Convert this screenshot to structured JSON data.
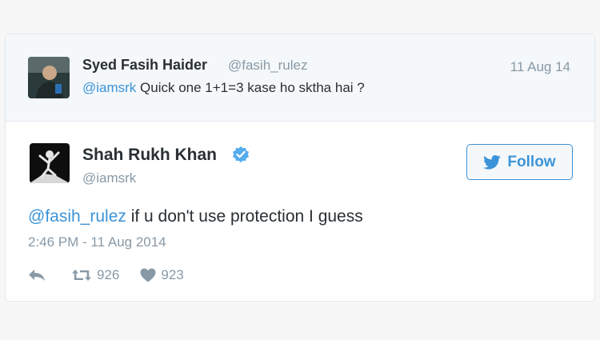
{
  "parent_tweet": {
    "author_name": "Syed Fasih Haider",
    "author_handle": "@fasih_rulez",
    "date": "11 Aug 14",
    "mention": "@iamsrk",
    "text": " Quick one 1+1=3 kase ho sktha hai ?"
  },
  "tweet": {
    "author_name": "Shah Rukh Khan",
    "author_handle": "@iamsrk",
    "verified_icon": "verified-badge-icon",
    "follow_label": "Follow",
    "mention": "@fasih_rulez",
    "text": " if u don't use protection I guess",
    "timestamp": "2:46 PM - 11 Aug 2014",
    "retweets": "926",
    "likes": "923"
  },
  "colors": {
    "accent": "#3b94d9",
    "muted": "#8899a6",
    "text": "#292f33",
    "parent_bg": "#f5f8fa"
  }
}
